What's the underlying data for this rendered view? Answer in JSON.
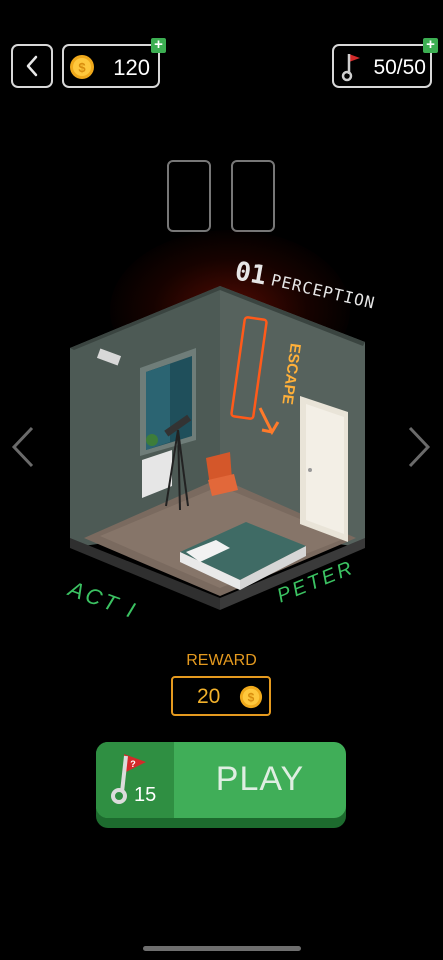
{
  "header": {
    "coins": "120",
    "keys": "50/50"
  },
  "level": {
    "number": "01",
    "name": "PERCEPTION",
    "neon_sign": "ESCAPE",
    "act": "ACT I",
    "owner": "PETER"
  },
  "reward": {
    "title": "REWARD",
    "value": "20"
  },
  "play": {
    "key_cost": "15",
    "label": "PLAY"
  },
  "colors": {
    "accent_green": "#40ae58",
    "reward_orange": "#e59a1f",
    "neon": "#ff8a2a"
  },
  "icons": [
    "back-icon",
    "coin-icon",
    "plus-icon",
    "key-icon",
    "chevron-left-icon",
    "chevron-right-icon"
  ]
}
